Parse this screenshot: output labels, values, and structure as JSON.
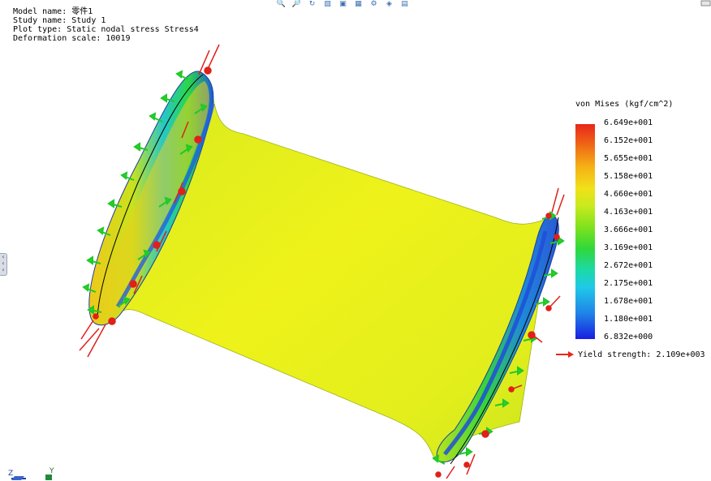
{
  "info": {
    "model_name": "Model name: 零件1",
    "study_name": "Study name: Study 1",
    "plot_type": "Plot type: Static nodal stress Stress4",
    "deformation_scale": "Deformation scale: 10019"
  },
  "legend": {
    "title": "von Mises (kgf/cm^2)",
    "ticks": [
      "6.649e+001",
      "6.152e+001",
      "5.655e+001",
      "5.158e+001",
      "4.660e+001",
      "4.163e+001",
      "3.666e+001",
      "3.169e+001",
      "2.672e+001",
      "2.175e+001",
      "1.678e+001",
      "1.180e+001",
      "6.832e+000"
    ],
    "yield_label": "Yield strength: 2.109e+003"
  },
  "triad": {
    "z": "Z",
    "y": "Y"
  },
  "toolbar": {
    "icons": [
      "zoom-to-fit-icon",
      "zoom-area-icon",
      "rotate-icon",
      "section-view-icon",
      "view-orientation-icon",
      "display-style-icon",
      "hide-show-icon",
      "appearance-icon",
      "scene-icon"
    ]
  },
  "colors": {
    "yield_arrow": "#e8261a",
    "load_arrow": "#e0201a",
    "fixture": "#25d62a",
    "body": "#e4ec1c"
  }
}
